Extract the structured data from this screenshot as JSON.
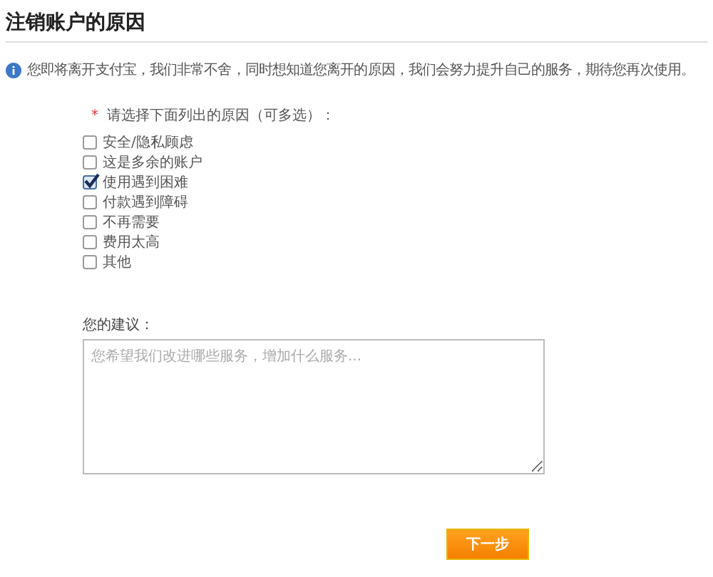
{
  "title": "注销账户的原因",
  "notice": "您即将离开支付宝，我们非常不舍，同时想知道您离开的原因，我们会努力提升自己的服务，期待您再次使用。",
  "reasons": {
    "required_mark": "*",
    "prompt": "请选择下面列出的原因（可多选）：",
    "options": [
      {
        "label": "安全/隐私顾虑",
        "checked": false
      },
      {
        "label": "这是多余的账户",
        "checked": false
      },
      {
        "label": "使用遇到困难",
        "checked": true
      },
      {
        "label": "付款遇到障碍",
        "checked": false
      },
      {
        "label": "不再需要",
        "checked": false
      },
      {
        "label": "费用太高",
        "checked": false
      },
      {
        "label": "其他",
        "checked": false
      }
    ]
  },
  "suggestion": {
    "label": "您的建议：",
    "placeholder": "您希望我们改进哪些服务，增加什么服务..."
  },
  "buttons": [
    {
      "label": "下一步"
    }
  ]
}
